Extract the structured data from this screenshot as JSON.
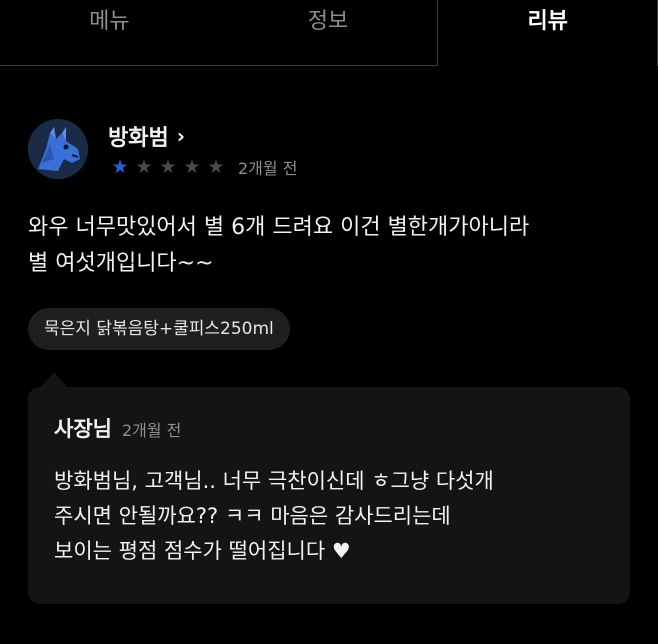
{
  "tabs": [
    {
      "label": "메뉴",
      "active": false
    },
    {
      "label": "정보",
      "active": false
    },
    {
      "label": "리뷰",
      "active": true
    }
  ],
  "review": {
    "author": "방화범",
    "author_chevron": "›",
    "rating": 1,
    "rating_max": 5,
    "date": "2개월 전",
    "text_lines": [
      "와우 너무맛있어서 별 6개 드려요 이건  별한개가아니라",
      "별 여섯개입니다~~"
    ],
    "menu_tag": "묵은지 닭볶음탕+쿨피스250ml"
  },
  "reply": {
    "author": "사장님",
    "date": "2개월 전",
    "text_lines": [
      "방화범님, 고객님..   너무 극찬이신데 ㅎ그냥 다섯개",
      "주시면 안될까요?? ㅋㅋ  마음은 감사드리는데",
      "보이는 평점 점수가 떨어집니다 ♥"
    ]
  },
  "colors": {
    "background": "#000000",
    "star_filled": "#2d5bd7",
    "star_empty": "#4a4a4a",
    "muted_text": "#8e8e8e",
    "reply_bg": "#141414"
  },
  "icons": {
    "avatar": "horse-avatar-icon",
    "chevron": "chevron-right-icon",
    "star": "star-icon"
  }
}
